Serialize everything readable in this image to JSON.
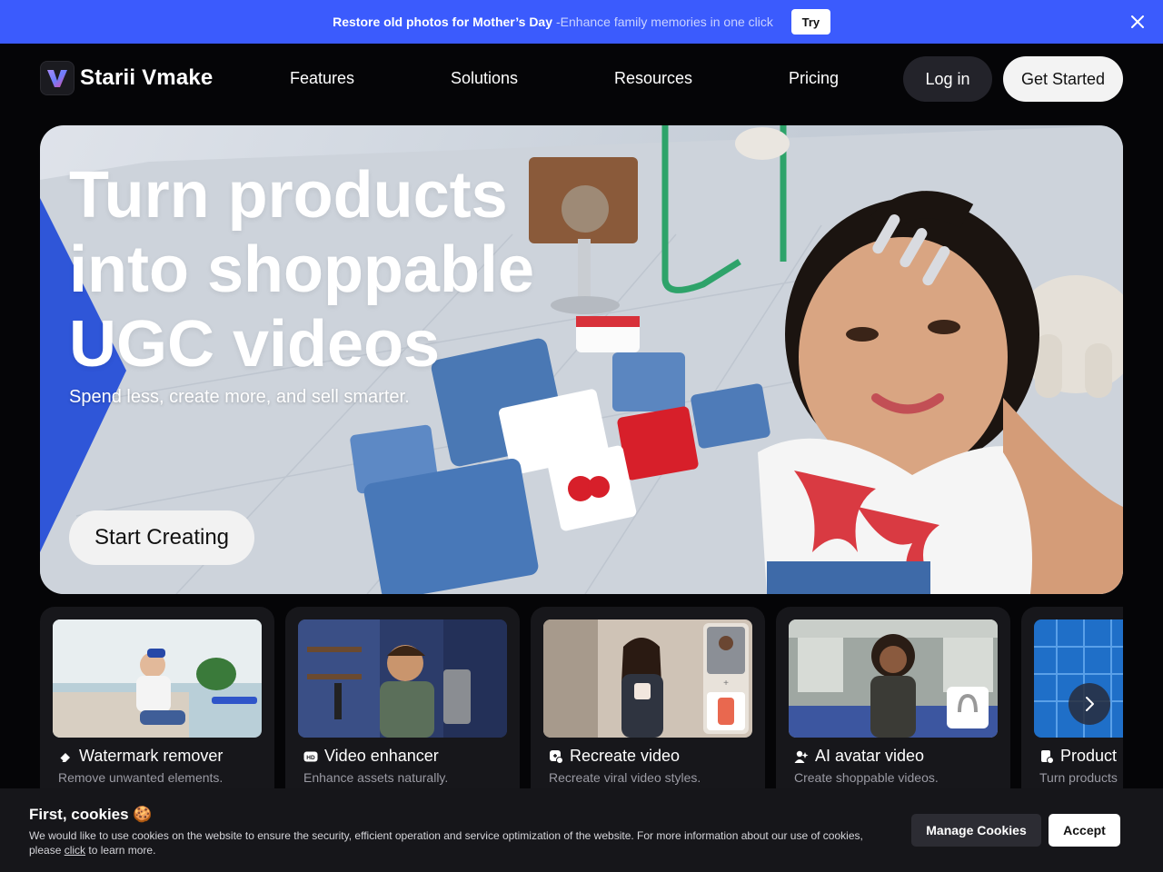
{
  "promo": {
    "highlight": "Restore old photos for Mother’s Day",
    "text": "-Enhance family memories in one click",
    "try_label": "Try"
  },
  "header": {
    "brand": "Starii Vmake",
    "nav": [
      "Features",
      "Solutions",
      "Resources",
      "Pricing"
    ],
    "login_label": "Log in",
    "get_started_label": "Get Started"
  },
  "hero": {
    "title_lines": [
      "Turn products",
      "into shoppable",
      "UGC videos"
    ],
    "subtitle": "Spend less, create more, and sell smarter.",
    "cta_label": "Start Creating"
  },
  "cards": [
    {
      "title": "Watermark remover",
      "desc": "Remove unwanted elements.",
      "icon": "eraser-icon"
    },
    {
      "title": "Video enhancer",
      "desc": "Enhance assets naturally.",
      "icon": "hd-icon"
    },
    {
      "title": "Recreate video",
      "desc": "Recreate viral video styles.",
      "icon": "recreate-icon"
    },
    {
      "title": "AI avatar video",
      "desc": "Create shoppable videos.",
      "icon": "avatar-icon"
    },
    {
      "title": "Product",
      "desc": "Turn products",
      "icon": "product-icon"
    }
  ],
  "cookie": {
    "title": "First, cookies 🍪",
    "text_before": "We would like to use cookies on the website to ensure the security, efficient operation and service optimization of the website. For more information about our use of cookies, please ",
    "link": "click",
    "text_after": " to learn more.",
    "manage_label": "Manage Cookies",
    "accept_label": "Accept"
  },
  "colors": {
    "promo_bg": "#3b5bfd",
    "page_bg": "#050507",
    "card_bg": "#17171b"
  }
}
